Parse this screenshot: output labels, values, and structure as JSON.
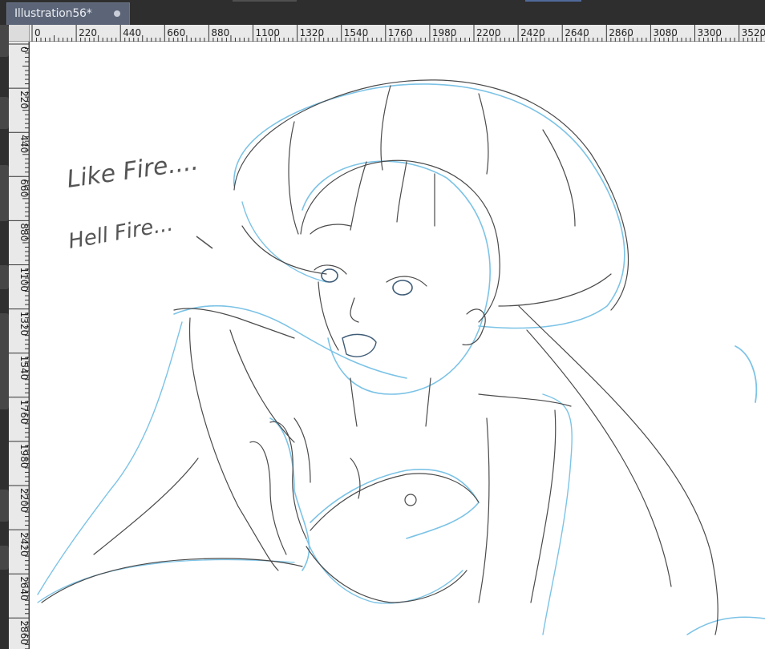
{
  "document_tab": {
    "title": "Illustration56*",
    "modified_dot_icon": "circle-dot-icon"
  },
  "rulers": {
    "horizontal_labels": [
      "0",
      "220",
      "440",
      "660",
      "880",
      "1100",
      "1320",
      "1540",
      "1760",
      "1980",
      "2200",
      "2420",
      "2640",
      "2860",
      "3080",
      "3300",
      "3520"
    ],
    "vertical_labels": [
      "0",
      "220",
      "440",
      "660",
      "880",
      "1100",
      "1320",
      "1540",
      "1760",
      "1980",
      "2200",
      "2420",
      "2640",
      "2860"
    ]
  },
  "canvas": {
    "annotation_1": "Like Fire....",
    "annotation_2": "Hell Fire...",
    "line_colors": {
      "sketch_gray": "#4a4a4a",
      "sketch_blue": "#7cc3e6"
    }
  },
  "colors": {
    "tab_bg": "#5b6577",
    "chrome_bg": "#2e2e2e",
    "ruler_bg": "#e9e9e9"
  }
}
